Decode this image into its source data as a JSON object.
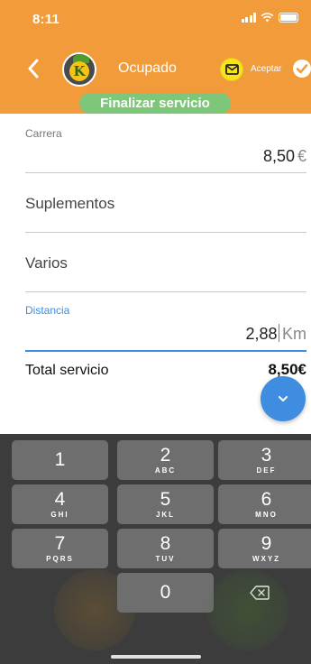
{
  "status_bar": {
    "time": "8:11"
  },
  "nav": {
    "state_label": "Ocupado",
    "accept_label": "Aceptar",
    "finish_label": "Finalizar servicio"
  },
  "form": {
    "carrera": {
      "label": "Carrera",
      "value": "8,50",
      "unit": "€"
    },
    "suplementos": {
      "placeholder": "Suplementos"
    },
    "varios": {
      "placeholder": "Varios"
    },
    "distancia": {
      "label": "Distancia",
      "value": "2,88",
      "unit": "Km"
    },
    "total": {
      "label": "Total servicio",
      "value": "8,50€"
    }
  },
  "keyboard": {
    "keys": [
      {
        "num": "1",
        "letters": ""
      },
      {
        "num": "2",
        "letters": "ABC"
      },
      {
        "num": "3",
        "letters": "DEF"
      },
      {
        "num": "4",
        "letters": "GHI"
      },
      {
        "num": "5",
        "letters": "JKL"
      },
      {
        "num": "6",
        "letters": "MNO"
      },
      {
        "num": "7",
        "letters": "PQRS"
      },
      {
        "num": "8",
        "letters": "TUV"
      },
      {
        "num": "9",
        "letters": "WXYZ"
      },
      {
        "num": "0",
        "letters": ""
      }
    ]
  },
  "colors": {
    "header": "#f29b3b",
    "finish_pill": "#7ec67a",
    "accent_blue": "#3f8de0",
    "keyboard_bg": "#3c3c3c",
    "key_bg": "#6e6e6e"
  },
  "icons": {
    "back": "chevron-left-icon",
    "message": "envelope-icon",
    "accept": "check-circle-icon",
    "fab": "chevron-down-icon",
    "delete": "backspace-icon"
  }
}
